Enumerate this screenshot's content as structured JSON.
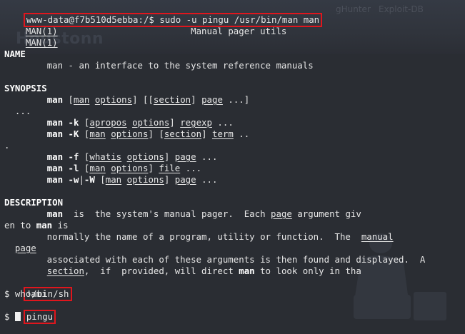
{
  "background": {
    "watermark": "Heustonn",
    "tabs": [
      "gHunter",
      "Exploit-DB"
    ]
  },
  "terminal": {
    "prompt_command": "www-data@f7b510d5ebba:/$ sudo -u pingu /usr/bin/man man",
    "header_left": "MAN(1)",
    "header_center": "Manual pager utils",
    "header_left2": "MAN(1)",
    "name_heading": "NAME",
    "name_text": "man - an interface to the system reference manuals",
    "synopsis_heading": "SYNOPSIS",
    "description_heading": "DESCRIPTION",
    "shell_prompt": "!/bin/sh",
    "whoami_cmd": "$ whoami",
    "whoami_output": "pingu",
    "final_prompt": "$ "
  },
  "colors": {
    "highlight_box": "#e0161d",
    "background": "#2a2d33",
    "text": "#e6e6e6"
  }
}
